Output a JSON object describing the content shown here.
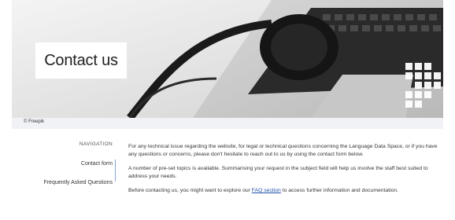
{
  "hero": {
    "title": "Contact us",
    "credit": "© Freepik"
  },
  "sidebar": {
    "heading": "NAVIGATION",
    "items": [
      {
        "label": "Contact form"
      },
      {
        "label": "Frequently Asked Questions"
      }
    ]
  },
  "main": {
    "p1": "For any technical issue regarding the website, for legal or technical questions concerning the Language Data Space, or if you have any questions or concerns, please don't hesitate to reach out to us by using the contact form below.",
    "p2": "A number of pre-set topics is available. Summarising your request in the subject field will help us involve the staff best suited to address your needs.",
    "p3_before": "Before contacting us, you might want to explore our ",
    "p3_link": "FAQ section",
    "p3_after": " to access further information and documentation."
  },
  "colors": {
    "link": "#1d4fa8",
    "credit_bar": "#f1f2f6",
    "nav_accent": "#8aa6d6"
  }
}
